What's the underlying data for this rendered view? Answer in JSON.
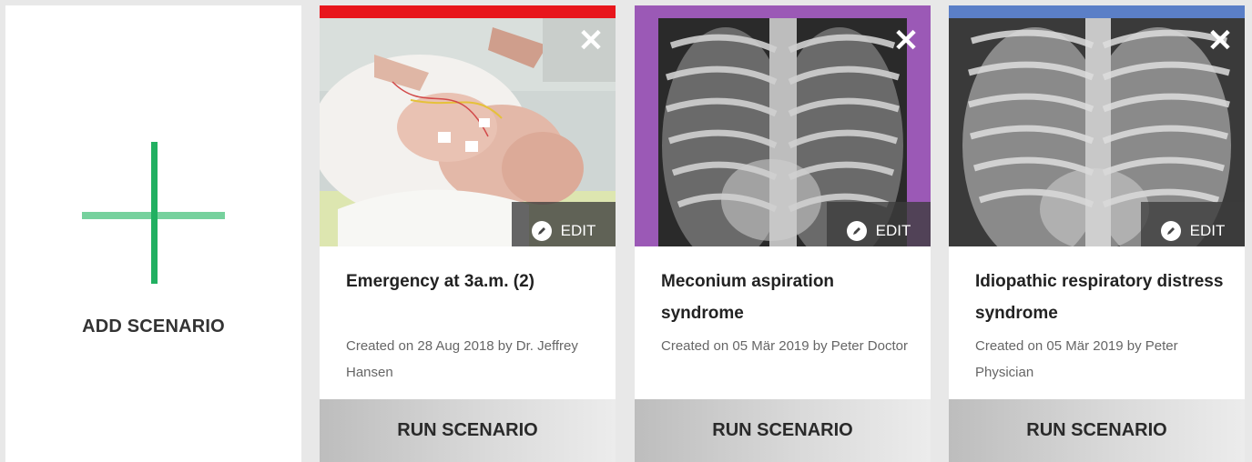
{
  "add_card": {
    "label": "ADD SCENARIO",
    "icon": "plus-icon"
  },
  "cards": [
    {
      "accent": "#e8161c",
      "title": "Emergency at 3a.m. (2)",
      "meta": "Created on 28 Aug 2018 by Dr. Jeffrey Hansen",
      "edit_label": "EDIT",
      "run_label": "RUN SCENARIO",
      "close_glyph": "✕",
      "image": "newborn-photo"
    },
    {
      "accent": "#9b59b6",
      "title": "Meconium aspiration syndrome",
      "meta": "Created on 05 Mär 2019 by Peter Doctor",
      "edit_label": "EDIT",
      "run_label": "RUN SCENARIO",
      "close_glyph": "✕",
      "image": "chest-xray"
    },
    {
      "accent": "#5b7fc7",
      "title": "Idiopathic respiratory distress syndrome",
      "meta": "Created on 05 Mär 2019 by Peter Physician",
      "edit_label": "EDIT",
      "run_label": "RUN SCENARIO",
      "close_glyph": "✕",
      "image": "chest-xray"
    }
  ]
}
